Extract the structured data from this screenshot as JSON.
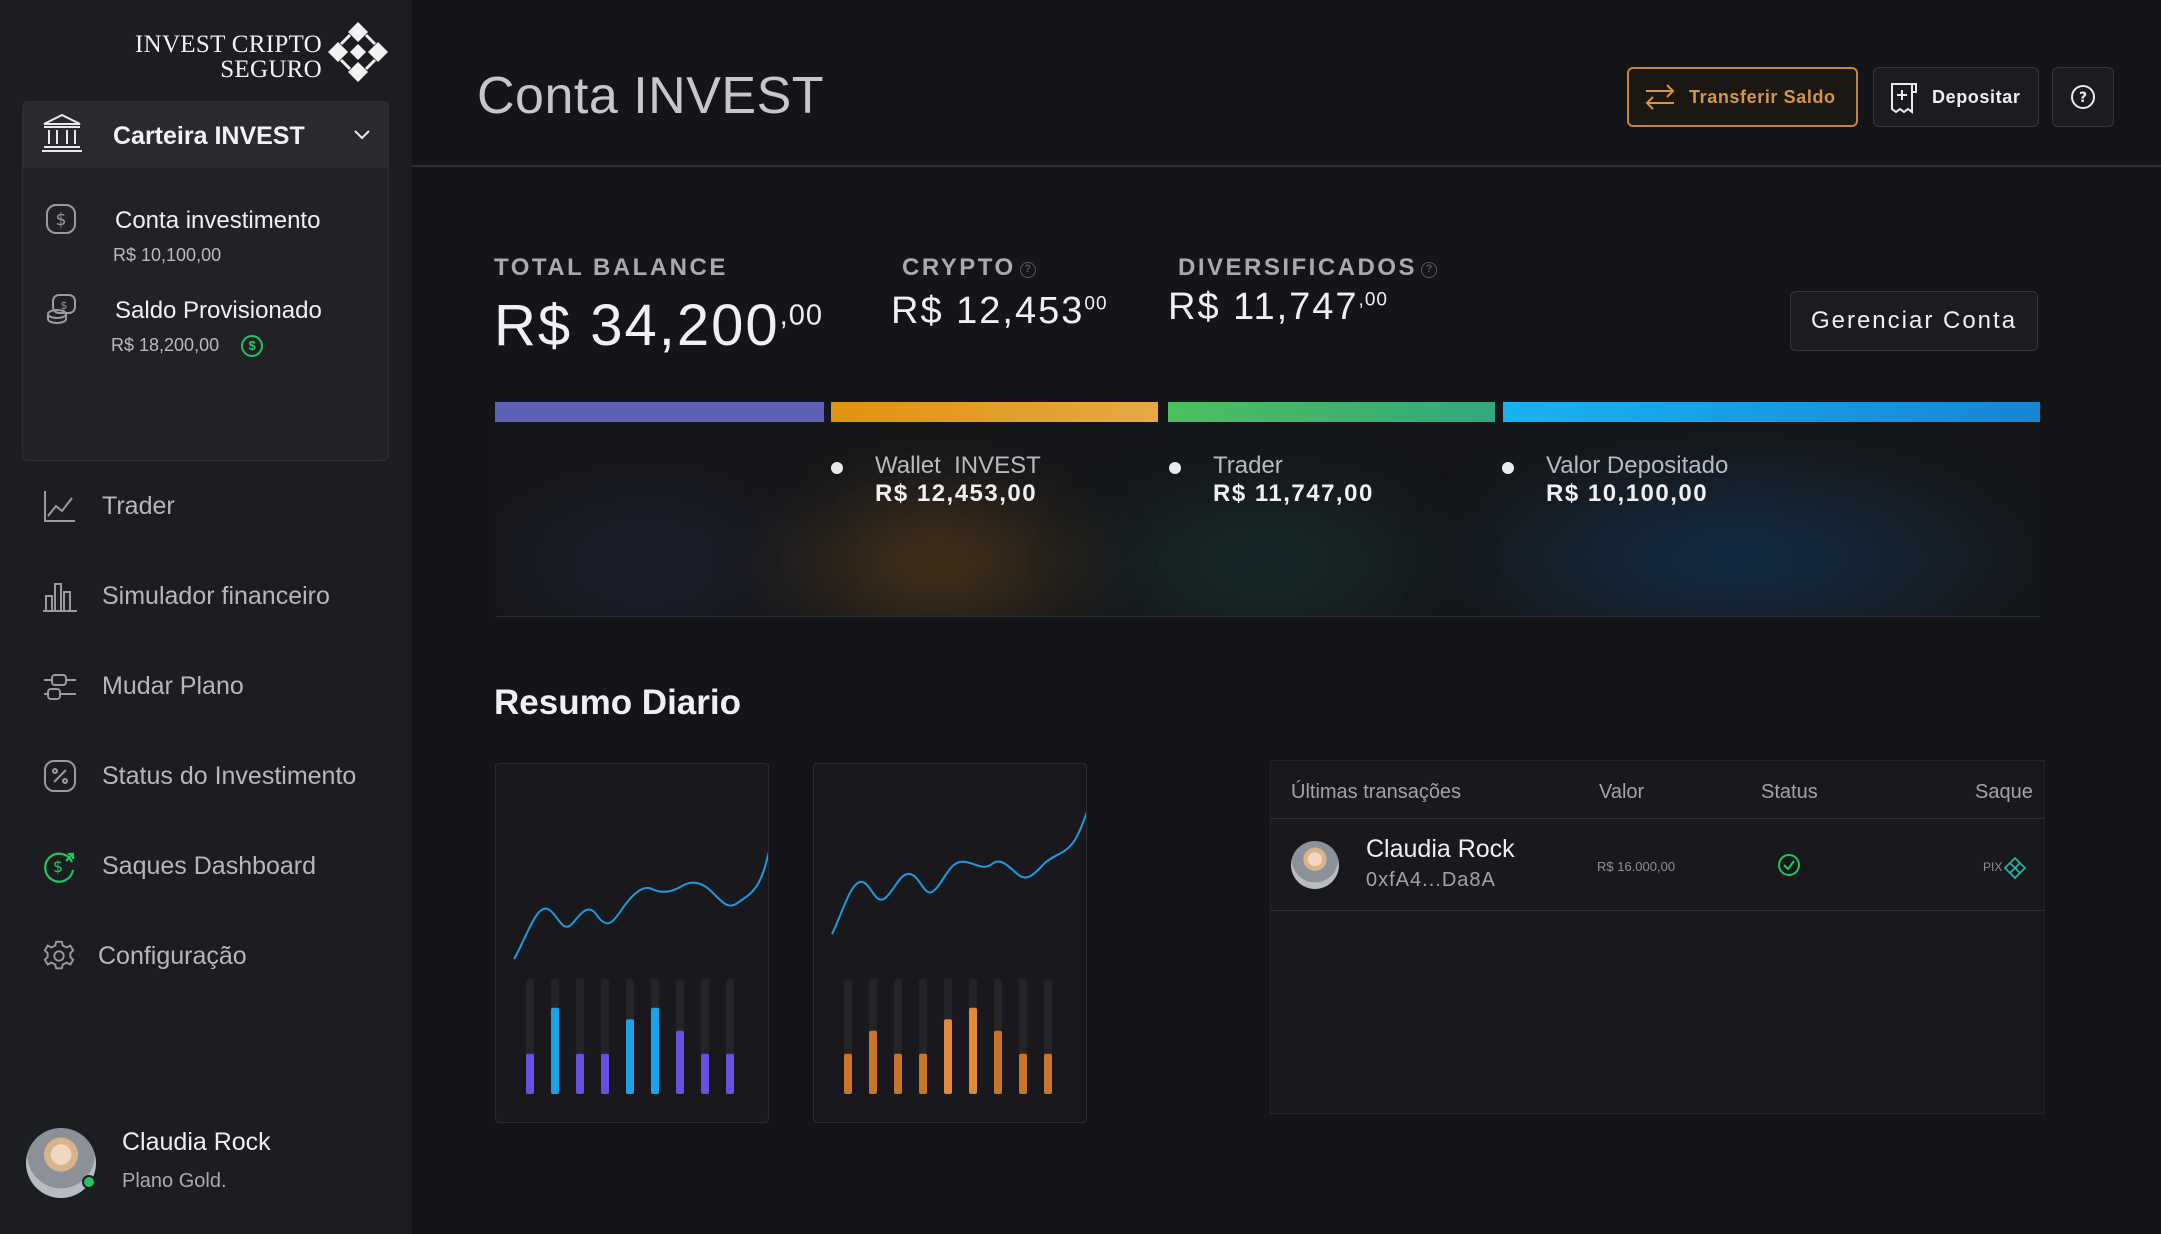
{
  "brand": {
    "line1": "INVEST CRIPTO",
    "line2": "SEGURO"
  },
  "wallet": {
    "title": "Carteira INVEST",
    "accounts": [
      {
        "name": "Conta investimento",
        "value": "R$ 10,100,00"
      },
      {
        "name": "Saldo Provisionado",
        "value": "R$ 18,200,00"
      }
    ]
  },
  "nav": [
    {
      "label": "Trader",
      "icon": "line-chart-icon"
    },
    {
      "label": "Simulador financeiro",
      "icon": "bar-chart-icon"
    },
    {
      "label": "Mudar Plano",
      "icon": "sliders-icon"
    },
    {
      "label": "Status do Investimento",
      "icon": "percent-icon"
    },
    {
      "label": "Saques Dashboard",
      "icon": "dollar-refresh-icon"
    },
    {
      "label": "Configuração",
      "icon": "gear-icon"
    }
  ],
  "user": {
    "name": "Claudia Rock",
    "plan": "Plano Gold."
  },
  "header": {
    "title": "Conta INVEST",
    "transfer_label": "Transferir Saldo",
    "deposit_label": "Depositar"
  },
  "balances": {
    "total": {
      "label": "TOTAL BALANCE",
      "main": "R$ 34,200",
      "cents": ",00"
    },
    "crypto": {
      "label": "CRYPTO",
      "main": "R$ 12,453",
      "cents": "00"
    },
    "diversificados": {
      "label": "DIVERSIFICADOS",
      "main": "R$ 11,747",
      "cents": ",00"
    },
    "manage_label": "Gerenciar Conta"
  },
  "distribution": {
    "legend": [
      {
        "name": "Wallet  INVEST",
        "value": "R$ 12,453,00"
      },
      {
        "name": "Trader",
        "value": "R$ 11,747,00"
      },
      {
        "name": "Valor Depositado",
        "value": "R$ 10,100,00"
      }
    ],
    "colors": [
      "#5b5fb5",
      "#e0930f",
      "#4cbf5f",
      "#19b2f2"
    ]
  },
  "resumo": {
    "title": "Resumo Diario",
    "cards": [
      {
        "line_color": "#1d9be0",
        "bar_colors": [
          "#6b4fe0",
          "#1aa3e8"
        ],
        "bars": [
          0.35,
          0.75,
          0.35,
          0.35,
          0.65,
          0.75,
          0.55,
          0.35,
          0.35
        ]
      },
      {
        "line_color": "#1d9be0",
        "bar_colors": [
          "#c8742a",
          "#e08a3a"
        ],
        "bars": [
          0.35,
          0.55,
          0.35,
          0.35,
          0.65,
          0.75,
          0.55,
          0.35,
          0.35
        ]
      }
    ]
  },
  "transactions": {
    "headers": {
      "title": "Últimas transações",
      "value": "Valor",
      "status": "Status",
      "withdraw": "Saque"
    },
    "rows": [
      {
        "name": "Claudia Rock",
        "address": "0xfA4...Da8A",
        "value": "R$ 16.000,00",
        "method": "PIX"
      }
    ]
  }
}
